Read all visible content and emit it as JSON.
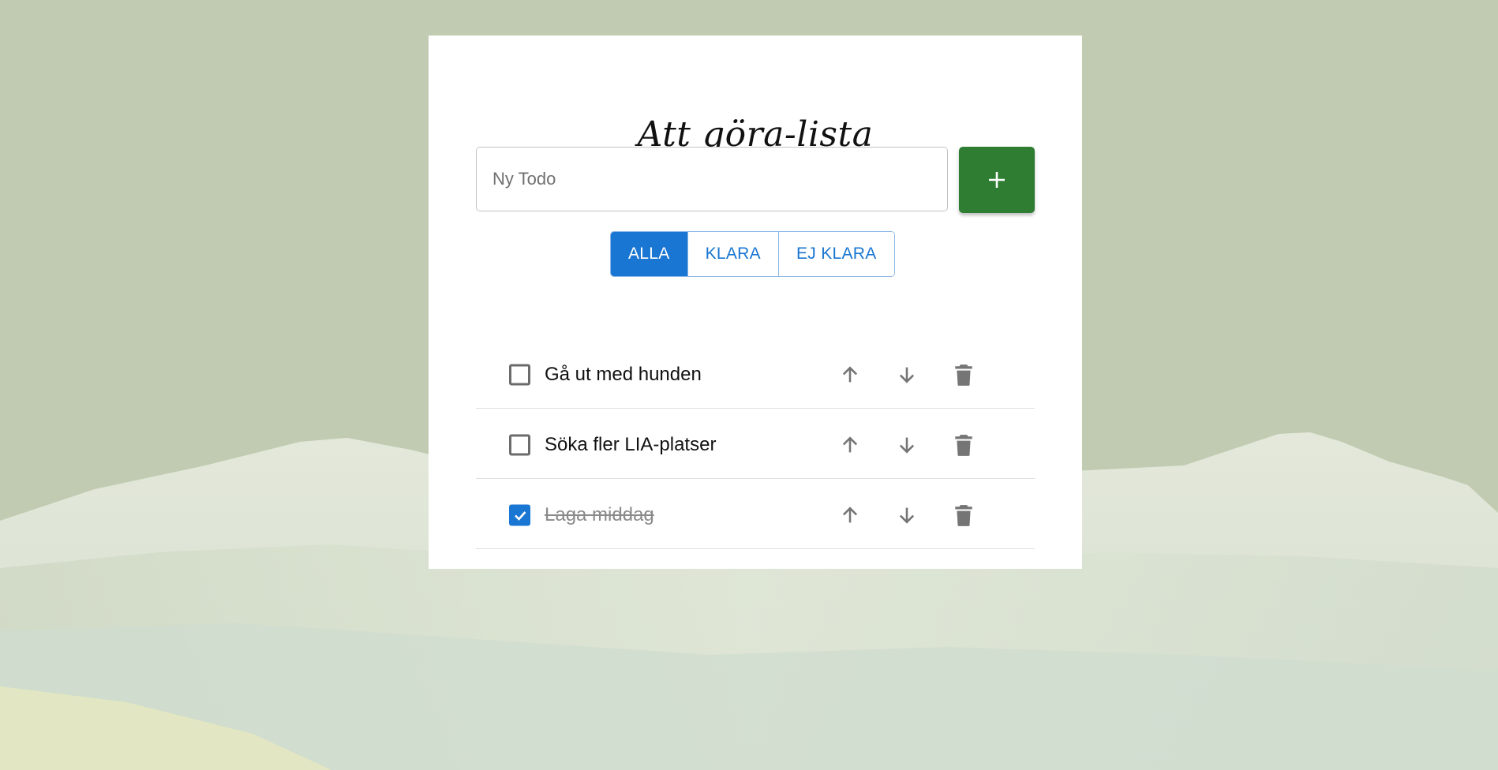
{
  "app": {
    "title": "Att göra-lista"
  },
  "new_todo": {
    "placeholder": "Ny Todo",
    "value": "",
    "add_icon": "plus-icon",
    "add_button_color": "#2e7d32"
  },
  "filters": {
    "active": "ALLA",
    "items": [
      {
        "label": "ALLA"
      },
      {
        "label": "KLARA"
      },
      {
        "label": "EJ KLARA"
      }
    ],
    "accent_color": "#1976d2"
  },
  "todos": [
    {
      "text": "Gå ut med hunden",
      "done": false
    },
    {
      "text": "Söka fler LIA-platser",
      "done": false
    },
    {
      "text": "Laga middag",
      "done": true
    }
  ],
  "row_actions": {
    "up_icon": "arrow-up-icon",
    "down_icon": "arrow-down-icon",
    "delete_icon": "trash-icon"
  },
  "colors": {
    "page_background": "#c1cbb1",
    "card_background": "#ffffff",
    "icon_gray": "#757575"
  }
}
